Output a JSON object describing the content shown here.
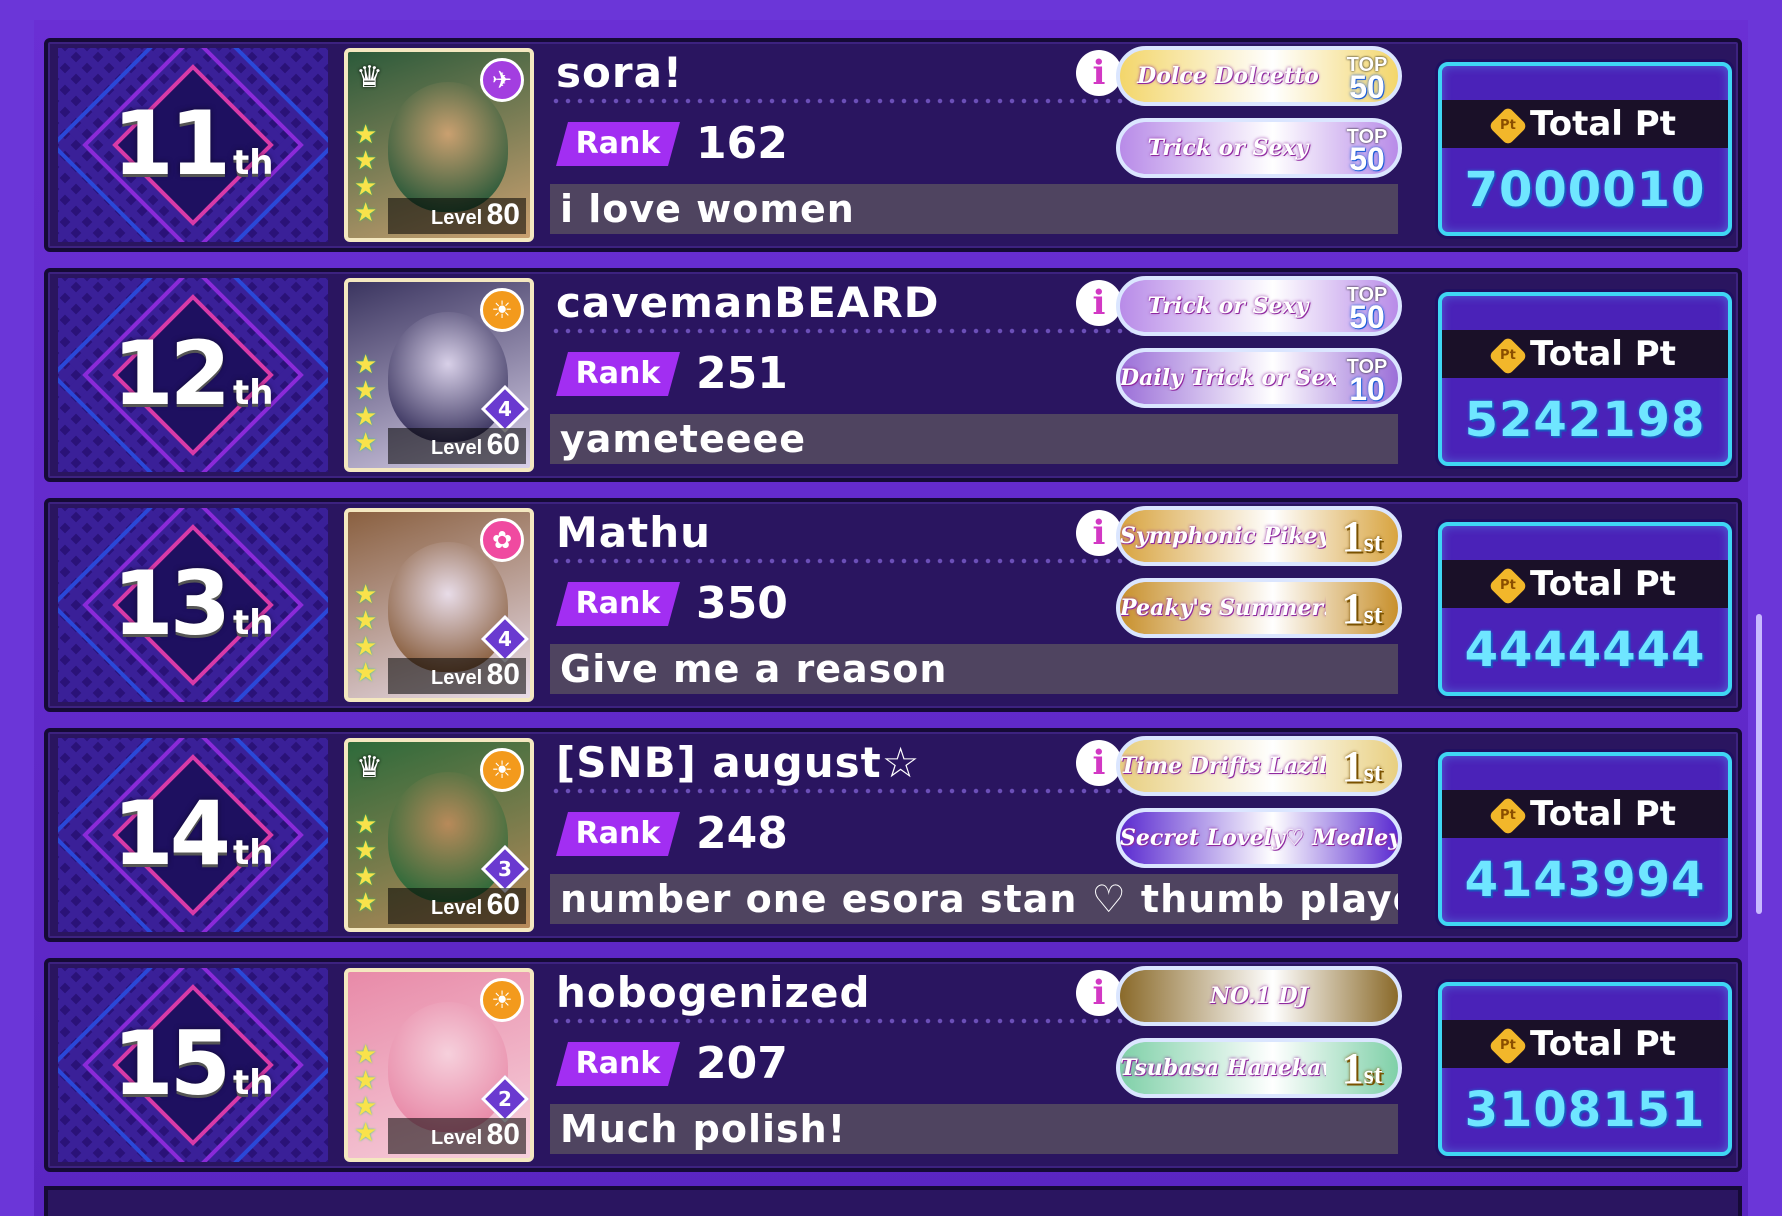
{
  "leaderboard": {
    "total_label": "Total Pt",
    "rank_label": "Rank",
    "coin_text": "Pt",
    "entries": [
      {
        "place": "11",
        "suffix": "th",
        "name": "sora!",
        "rank": "162",
        "level_label": "Level",
        "level": "80",
        "comment": "i love women",
        "total": "7000010",
        "attr_color": "#a33ee0",
        "attr_icon": "✈",
        "card_colors": [
          "#2b5a3a",
          "#caa070"
        ],
        "show_crown": true,
        "train": "",
        "badges": [
          {
            "text": "Dolce Dolcetto",
            "kind": "top",
            "top_label": "TOP",
            "top_value": "50",
            "bg": "#f3d66b"
          },
          {
            "text": "Trick or Sexy",
            "kind": "top",
            "top_label": "TOP",
            "top_value": "50",
            "bg": "#b88be8"
          }
        ]
      },
      {
        "place": "12",
        "suffix": "th",
        "name": "cavemanBEARD",
        "rank": "251",
        "level_label": "Level",
        "level": "60",
        "comment": "yameteeee",
        "total": "5242198",
        "attr_color": "#f39a1c",
        "attr_icon": "☀",
        "card_colors": [
          "#3b3560",
          "#d8d0e8"
        ],
        "show_crown": false,
        "train": "4",
        "badges": [
          {
            "text": "Trick or Sexy",
            "kind": "top",
            "top_label": "TOP",
            "top_value": "50",
            "bg": "#b88be8"
          },
          {
            "text": "Daily Trick or Sexy",
            "kind": "top",
            "top_label": "TOP",
            "top_value": "10",
            "bg": "#9b6fd8"
          }
        ]
      },
      {
        "place": "13",
        "suffix": "th",
        "name": "Mathu",
        "rank": "350",
        "level_label": "Level",
        "level": "80",
        "comment": "Give me a reason",
        "total": "4444444",
        "attr_color": "#f04aa0",
        "attr_icon": "✿",
        "card_colors": [
          "#8a6040",
          "#e8dce8"
        ],
        "show_crown": false,
        "train": "4",
        "badges": [
          {
            "text": "Symphonic Pikey's YEAR!!",
            "kind": "place",
            "place_value": "1",
            "place_suffix": "st",
            "bg": "#d8a440"
          },
          {
            "text": "Peaky's Summer!!",
            "kind": "place",
            "place_value": "1",
            "place_suffix": "st",
            "bg": "#c8902c"
          }
        ]
      },
      {
        "place": "14",
        "suffix": "th",
        "name": "[SNB] august☆",
        "rank": "248",
        "level_label": "Level",
        "level": "60",
        "comment": "number one esora stan ♡ thumb player",
        "total": "4143994",
        "attr_color": "#f39a1c",
        "attr_icon": "☀",
        "card_colors": [
          "#2d6a3a",
          "#b88a5a"
        ],
        "show_crown": true,
        "train": "3",
        "badges": [
          {
            "text": "Time Drifts Lazily",
            "kind": "place",
            "place_value": "1",
            "place_suffix": "st",
            "bg": "#e8cf80"
          },
          {
            "text": "Secret Lovely♡ Medley Full Combo",
            "kind": "plain",
            "bg": "#5a2ad0"
          }
        ]
      },
      {
        "place": "15",
        "suffix": "th",
        "name": "hobogenized",
        "rank": "207",
        "level_label": "Level",
        "level": "80",
        "comment": "Much polish!",
        "total": "3108151",
        "attr_color": "#f39a1c",
        "attr_icon": "☀",
        "card_colors": [
          "#e88aa8",
          "#f6d0dc"
        ],
        "show_crown": false,
        "train": "2",
        "badges": [
          {
            "text": "NO.1 DJ",
            "kind": "plain",
            "bg": "#8a6a2a"
          },
          {
            "text": "Tsubasa Hanekawa Support Pt Ranking",
            "kind": "place",
            "place_value": "1",
            "place_suffix": "st",
            "bg": "#7fd0a8"
          }
        ]
      }
    ]
  }
}
